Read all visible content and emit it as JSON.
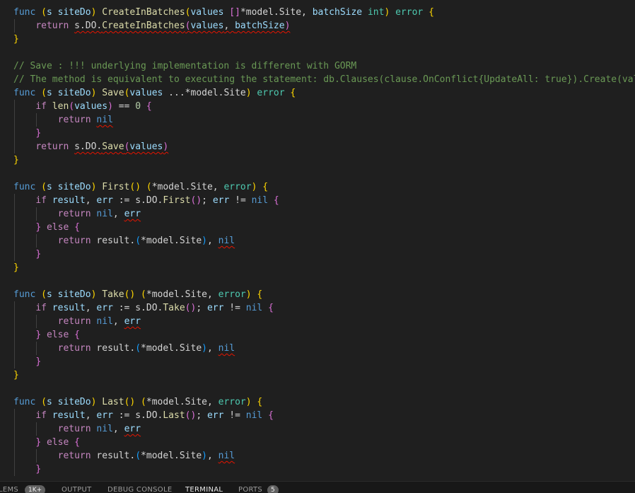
{
  "editor": {
    "language": "go",
    "lines": [
      {
        "guides": 0,
        "tokens": [
          [
            "kw",
            "func"
          ],
          [
            "pl",
            " "
          ],
          [
            "p1",
            "("
          ],
          [
            "var",
            "s"
          ],
          [
            "pl",
            " "
          ],
          [
            "var",
            "siteDo"
          ],
          [
            "p1",
            ")"
          ],
          [
            "pl",
            " "
          ],
          [
            "fn",
            "CreateInBatches"
          ],
          [
            "p1",
            "("
          ],
          [
            "var",
            "values"
          ],
          [
            "pl",
            " "
          ],
          [
            "p2",
            "[]"
          ],
          [
            "pl",
            "*model.Site, "
          ],
          [
            "var",
            "batchSize"
          ],
          [
            "pl",
            " "
          ],
          [
            "type",
            "int"
          ],
          [
            "p1",
            ")"
          ],
          [
            "pl",
            " "
          ],
          [
            "type",
            "error"
          ],
          [
            "pl",
            " "
          ],
          [
            "p1",
            "{"
          ]
        ]
      },
      {
        "guides": 1,
        "tokens": [
          [
            "ctl",
            "return"
          ],
          [
            "pl",
            " "
          ],
          [
            "sq",
            "s.DO."
          ],
          [
            "sqfn",
            "CreateInBatches"
          ],
          [
            "sqp2",
            "("
          ],
          [
            "sqvar",
            "values"
          ],
          [
            "sq",
            ", "
          ],
          [
            "sqvar",
            "batchSize"
          ],
          [
            "sqp2",
            ")"
          ]
        ]
      },
      {
        "guides": 0,
        "tokens": [
          [
            "p1",
            "}"
          ]
        ]
      },
      {
        "guides": 0,
        "tokens": []
      },
      {
        "guides": 0,
        "tokens": [
          [
            "cmt",
            "// Save : !!! underlying implementation is different with GORM"
          ]
        ]
      },
      {
        "guides": 0,
        "tokens": [
          [
            "cmt",
            "// The method is equivalent to executing the statement: db.Clauses(clause.OnConflict{UpdateAll: true}).Create(values)"
          ]
        ]
      },
      {
        "guides": 0,
        "tokens": [
          [
            "kw",
            "func"
          ],
          [
            "pl",
            " "
          ],
          [
            "p1",
            "("
          ],
          [
            "var",
            "s"
          ],
          [
            "pl",
            " "
          ],
          [
            "var",
            "siteDo"
          ],
          [
            "p1",
            ")"
          ],
          [
            "pl",
            " "
          ],
          [
            "fn",
            "Save"
          ],
          [
            "p1",
            "("
          ],
          [
            "var",
            "values"
          ],
          [
            "pl",
            " ...*model.Site"
          ],
          [
            "p1",
            ")"
          ],
          [
            "pl",
            " "
          ],
          [
            "type",
            "error"
          ],
          [
            "pl",
            " "
          ],
          [
            "p1",
            "{"
          ]
        ]
      },
      {
        "guides": 1,
        "tokens": [
          [
            "ctl",
            "if"
          ],
          [
            "pl",
            " "
          ],
          [
            "fn",
            "len"
          ],
          [
            "p2",
            "("
          ],
          [
            "var",
            "values"
          ],
          [
            "p2",
            ")"
          ],
          [
            "pl",
            " == "
          ],
          [
            "num",
            "0"
          ],
          [
            "pl",
            " "
          ],
          [
            "p2",
            "{"
          ]
        ]
      },
      {
        "guides": 2,
        "tokens": [
          [
            "ctl",
            "return"
          ],
          [
            "pl",
            " "
          ],
          [
            "sqkw",
            "nil"
          ]
        ]
      },
      {
        "guides": 1,
        "tokens": [
          [
            "p2",
            "}"
          ]
        ]
      },
      {
        "guides": 1,
        "tokens": [
          [
            "ctl",
            "return"
          ],
          [
            "pl",
            " "
          ],
          [
            "sq",
            "s.DO."
          ],
          [
            "sqfn",
            "Save"
          ],
          [
            "sqp2",
            "("
          ],
          [
            "sqvar",
            "values"
          ],
          [
            "sqp2",
            ")"
          ]
        ]
      },
      {
        "guides": 0,
        "tokens": [
          [
            "p1",
            "}"
          ]
        ]
      },
      {
        "guides": 0,
        "tokens": []
      },
      {
        "guides": 0,
        "tokens": [
          [
            "kw",
            "func"
          ],
          [
            "pl",
            " "
          ],
          [
            "p1",
            "("
          ],
          [
            "var",
            "s"
          ],
          [
            "pl",
            " "
          ],
          [
            "var",
            "siteDo"
          ],
          [
            "p1",
            ")"
          ],
          [
            "pl",
            " "
          ],
          [
            "fn",
            "First"
          ],
          [
            "p1",
            "()"
          ],
          [
            "pl",
            " "
          ],
          [
            "p1",
            "("
          ],
          [
            "pl",
            "*model.Site, "
          ],
          [
            "type",
            "error"
          ],
          [
            "p1",
            ")"
          ],
          [
            "pl",
            " "
          ],
          [
            "p1",
            "{"
          ]
        ]
      },
      {
        "guides": 1,
        "tokens": [
          [
            "ctl",
            "if"
          ],
          [
            "pl",
            " "
          ],
          [
            "var",
            "result"
          ],
          [
            "pl",
            ", "
          ],
          [
            "var",
            "err"
          ],
          [
            "pl",
            " := s.DO."
          ],
          [
            "fn",
            "First"
          ],
          [
            "p2",
            "()"
          ],
          [
            "pl",
            "; "
          ],
          [
            "var",
            "err"
          ],
          [
            "pl",
            " != "
          ],
          [
            "kw",
            "nil"
          ],
          [
            "pl",
            " "
          ],
          [
            "p2",
            "{"
          ]
        ]
      },
      {
        "guides": 2,
        "tokens": [
          [
            "ctl",
            "return"
          ],
          [
            "pl",
            " "
          ],
          [
            "kw",
            "nil"
          ],
          [
            "pl",
            ", "
          ],
          [
            "sqvar",
            "err"
          ]
        ]
      },
      {
        "guides": 1,
        "tokens": [
          [
            "p2",
            "}"
          ],
          [
            "pl",
            " "
          ],
          [
            "ctl",
            "else"
          ],
          [
            "pl",
            " "
          ],
          [
            "p2",
            "{"
          ]
        ]
      },
      {
        "guides": 2,
        "tokens": [
          [
            "ctl",
            "return"
          ],
          [
            "pl",
            " result."
          ],
          [
            "p3",
            "("
          ],
          [
            "pl",
            "*model.Site"
          ],
          [
            "p3",
            ")"
          ],
          [
            "pl",
            ", "
          ],
          [
            "sqkw",
            "nil"
          ]
        ]
      },
      {
        "guides": 1,
        "tokens": [
          [
            "p2",
            "}"
          ]
        ]
      },
      {
        "guides": 0,
        "tokens": [
          [
            "p1",
            "}"
          ]
        ]
      },
      {
        "guides": 0,
        "tokens": []
      },
      {
        "guides": 0,
        "tokens": [
          [
            "kw",
            "func"
          ],
          [
            "pl",
            " "
          ],
          [
            "p1",
            "("
          ],
          [
            "var",
            "s"
          ],
          [
            "pl",
            " "
          ],
          [
            "var",
            "siteDo"
          ],
          [
            "p1",
            ")"
          ],
          [
            "pl",
            " "
          ],
          [
            "fn",
            "Take"
          ],
          [
            "p1",
            "()"
          ],
          [
            "pl",
            " "
          ],
          [
            "p1",
            "("
          ],
          [
            "pl",
            "*model.Site, "
          ],
          [
            "type",
            "error"
          ],
          [
            "p1",
            ")"
          ],
          [
            "pl",
            " "
          ],
          [
            "p1",
            "{"
          ]
        ]
      },
      {
        "guides": 1,
        "tokens": [
          [
            "ctl",
            "if"
          ],
          [
            "pl",
            " "
          ],
          [
            "var",
            "result"
          ],
          [
            "pl",
            ", "
          ],
          [
            "var",
            "err"
          ],
          [
            "pl",
            " := s.DO."
          ],
          [
            "fn",
            "Take"
          ],
          [
            "p2",
            "()"
          ],
          [
            "pl",
            "; "
          ],
          [
            "var",
            "err"
          ],
          [
            "pl",
            " != "
          ],
          [
            "kw",
            "nil"
          ],
          [
            "pl",
            " "
          ],
          [
            "p2",
            "{"
          ]
        ]
      },
      {
        "guides": 2,
        "tokens": [
          [
            "ctl",
            "return"
          ],
          [
            "pl",
            " "
          ],
          [
            "kw",
            "nil"
          ],
          [
            "pl",
            ", "
          ],
          [
            "sqvar",
            "err"
          ]
        ]
      },
      {
        "guides": 1,
        "tokens": [
          [
            "p2",
            "}"
          ],
          [
            "pl",
            " "
          ],
          [
            "ctl",
            "else"
          ],
          [
            "pl",
            " "
          ],
          [
            "p2",
            "{"
          ]
        ]
      },
      {
        "guides": 2,
        "tokens": [
          [
            "ctl",
            "return"
          ],
          [
            "pl",
            " result."
          ],
          [
            "p3",
            "("
          ],
          [
            "pl",
            "*model.Site"
          ],
          [
            "p3",
            ")"
          ],
          [
            "pl",
            ", "
          ],
          [
            "sqkw",
            "nil"
          ]
        ]
      },
      {
        "guides": 1,
        "tokens": [
          [
            "p2",
            "}"
          ]
        ]
      },
      {
        "guides": 0,
        "tokens": [
          [
            "p1",
            "}"
          ]
        ]
      },
      {
        "guides": 0,
        "tokens": []
      },
      {
        "guides": 0,
        "tokens": [
          [
            "kw",
            "func"
          ],
          [
            "pl",
            " "
          ],
          [
            "p1",
            "("
          ],
          [
            "var",
            "s"
          ],
          [
            "pl",
            " "
          ],
          [
            "var",
            "siteDo"
          ],
          [
            "p1",
            ")"
          ],
          [
            "pl",
            " "
          ],
          [
            "fn",
            "Last"
          ],
          [
            "p1",
            "()"
          ],
          [
            "pl",
            " "
          ],
          [
            "p1",
            "("
          ],
          [
            "pl",
            "*model.Site, "
          ],
          [
            "type",
            "error"
          ],
          [
            "p1",
            ")"
          ],
          [
            "pl",
            " "
          ],
          [
            "p1",
            "{"
          ]
        ]
      },
      {
        "guides": 1,
        "tokens": [
          [
            "ctl",
            "if"
          ],
          [
            "pl",
            " "
          ],
          [
            "var",
            "result"
          ],
          [
            "pl",
            ", "
          ],
          [
            "var",
            "err"
          ],
          [
            "pl",
            " := s.DO."
          ],
          [
            "fn",
            "Last"
          ],
          [
            "p2",
            "()"
          ],
          [
            "pl",
            "; "
          ],
          [
            "var",
            "err"
          ],
          [
            "pl",
            " != "
          ],
          [
            "kw",
            "nil"
          ],
          [
            "pl",
            " "
          ],
          [
            "p2",
            "{"
          ]
        ]
      },
      {
        "guides": 2,
        "tokens": [
          [
            "ctl",
            "return"
          ],
          [
            "pl",
            " "
          ],
          [
            "kw",
            "nil"
          ],
          [
            "pl",
            ", "
          ],
          [
            "sqvar",
            "err"
          ]
        ]
      },
      {
        "guides": 1,
        "tokens": [
          [
            "p2",
            "}"
          ],
          [
            "pl",
            " "
          ],
          [
            "ctl",
            "else"
          ],
          [
            "pl",
            " "
          ],
          [
            "p2",
            "{"
          ]
        ]
      },
      {
        "guides": 2,
        "tokens": [
          [
            "ctl",
            "return"
          ],
          [
            "pl",
            " result."
          ],
          [
            "p3",
            "("
          ],
          [
            "pl",
            "*model.Site"
          ],
          [
            "p3",
            ")"
          ],
          [
            "pl",
            ", "
          ],
          [
            "sqkw",
            "nil"
          ]
        ]
      },
      {
        "guides": 1,
        "tokens": [
          [
            "p2",
            "}"
          ]
        ]
      }
    ]
  },
  "panel": {
    "tabs": [
      {
        "id": "problems",
        "label": "LEMS",
        "badge": "1K+",
        "active": false
      },
      {
        "id": "output",
        "label": "OUTPUT",
        "badge": "",
        "active": false
      },
      {
        "id": "debug-console",
        "label": "DEBUG CONSOLE",
        "badge": "",
        "active": false
      },
      {
        "id": "terminal",
        "label": "TERMINAL",
        "badge": "",
        "active": true
      },
      {
        "id": "ports",
        "label": "PORTS",
        "badge": "5",
        "active": false
      }
    ]
  },
  "colors": {
    "background": "#1f1f1f",
    "keyword": "#569cd6",
    "control": "#c586c0",
    "function": "#dcdcaa",
    "type": "#4ec9b0",
    "variable": "#9cdcfe",
    "comment": "#6a9955",
    "error_squiggle": "#e51400"
  }
}
